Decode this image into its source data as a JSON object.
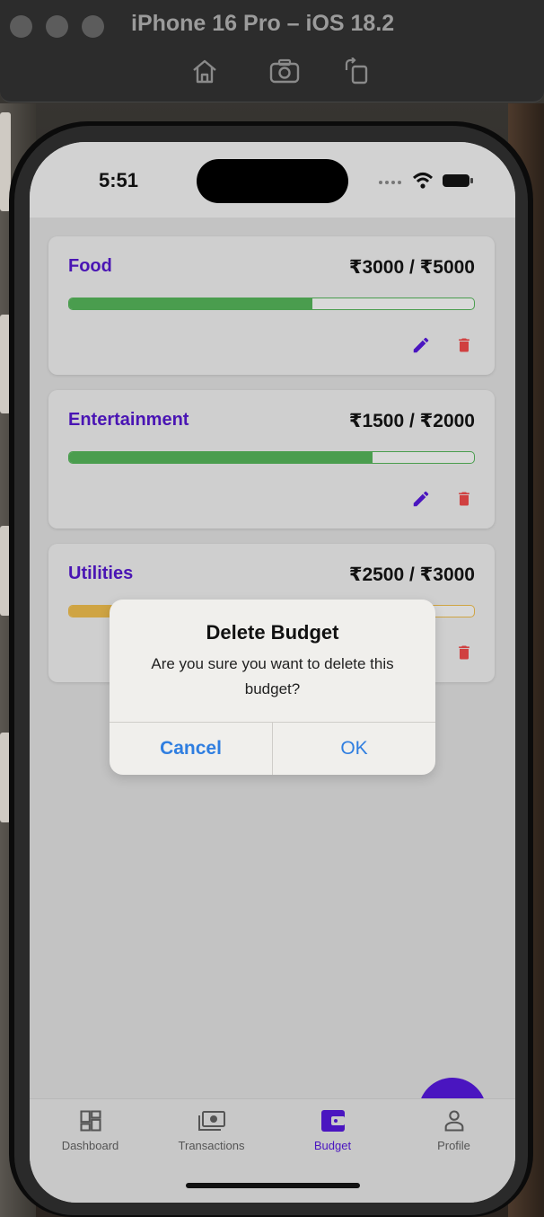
{
  "simulator": {
    "title": "iPhone 16 Pro – iOS 18.2",
    "buttons": [
      "home-icon",
      "screenshot-icon",
      "rotate-icon"
    ]
  },
  "status_bar": {
    "time": "5:51"
  },
  "budgets": [
    {
      "category": "Food",
      "amount": "₹3000 / ₹5000",
      "progress": 0.6,
      "status": "ok"
    },
    {
      "category": "Entertainment",
      "amount": "₹1500 / ₹2000",
      "progress": 0.75,
      "status": "ok"
    },
    {
      "category": "Utilities",
      "amount": "₹2500 / ₹3000",
      "progress": 0.83,
      "status": "warning"
    }
  ],
  "dialog": {
    "title": "Delete Budget",
    "message": "Are you sure you want to delete this budget?",
    "cancel_label": "Cancel",
    "ok_label": "OK"
  },
  "fab": {
    "label": "+"
  },
  "tabs": [
    {
      "label": "Dashboard",
      "icon": "dashboard-icon",
      "active": false
    },
    {
      "label": "Transactions",
      "icon": "money-icon",
      "active": false
    },
    {
      "label": "Budget",
      "icon": "wallet-icon",
      "active": true
    },
    {
      "label": "Profile",
      "icon": "person-icon",
      "active": false
    }
  ],
  "colors": {
    "accent": "#4a15c0",
    "progress_ok": "#4a9d4e",
    "progress_warning": "#cfa443",
    "delete": "#d04040",
    "dialog_button": "#2f7ee0"
  }
}
